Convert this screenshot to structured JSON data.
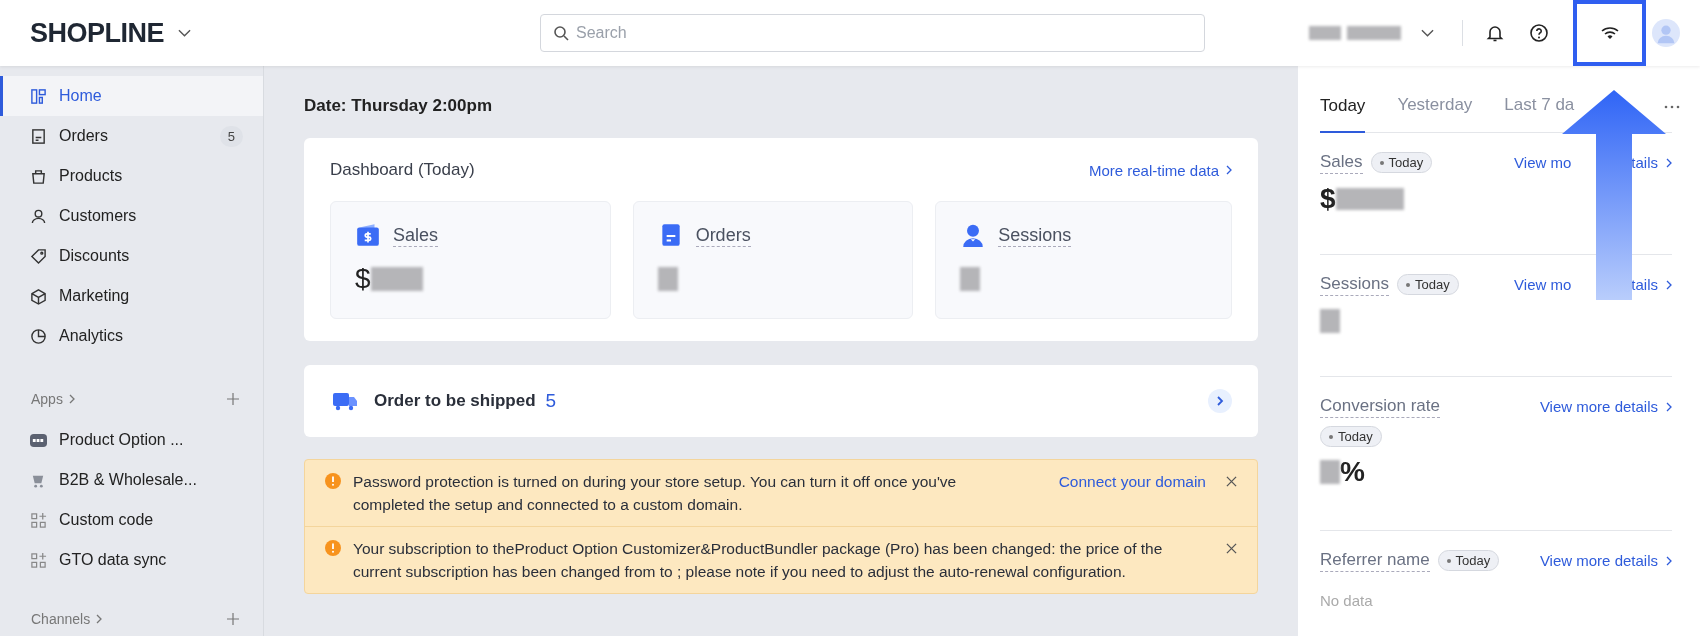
{
  "header": {
    "logo": "SHOPLINE",
    "search": {
      "placeholder": "Search"
    }
  },
  "sidebar": {
    "nav": [
      {
        "label": "Home",
        "selected": true
      },
      {
        "label": "Orders",
        "badge": "5",
        "selected": false
      },
      {
        "label": "Products",
        "selected": false
      },
      {
        "label": "Customers",
        "selected": false
      },
      {
        "label": "Discounts",
        "selected": false
      },
      {
        "label": "Marketing",
        "selected": false
      },
      {
        "label": "Analytics",
        "selected": false
      }
    ],
    "apps_header": "Apps",
    "apps": [
      {
        "label": "Product Option ..."
      },
      {
        "label": "B2B & Wholesale..."
      },
      {
        "label": "Custom code"
      },
      {
        "label": "GTO data sync"
      }
    ],
    "channels_header": "Channels"
  },
  "main": {
    "date": "Date: Thursday 2:00pm",
    "dashboard": {
      "title": "Dashboard (Today)",
      "link": "More real-time data",
      "stats": [
        {
          "label": "Sales",
          "prefix": "$"
        },
        {
          "label": "Orders"
        },
        {
          "label": "Sessions"
        }
      ]
    },
    "shipping": {
      "label": "Order to be shipped",
      "count": "5"
    },
    "alerts": [
      {
        "text": "Password protection is turned on during your store setup. You can turn it off once you've completed the setup and connected to a custom domain.",
        "link": "Connect your domain"
      },
      {
        "text": "Your subscription to theProduct Option Customizer&ProductBundler package (Pro) has been changed: the price of the current subscription has been changed from to ; please note if you need to adjust the auto-renewal configuration."
      }
    ]
  },
  "right_panel": {
    "tabs": [
      {
        "label": "Today",
        "selected": true
      },
      {
        "label": "Yesterday",
        "selected": false
      },
      {
        "label": "Last 7 da",
        "selected": false
      }
    ],
    "metrics": [
      {
        "label": "Sales",
        "badge": "Today",
        "kind": "inline",
        "link": [
          "View mo",
          "tails"
        ],
        "prefix": "$"
      },
      {
        "label": "Sessions",
        "badge": "Today",
        "kind": "inline",
        "link": [
          "View mo",
          "tails"
        ]
      },
      {
        "label": "Conversion rate",
        "badge": "Today",
        "kind": "below",
        "link": [
          "View more details"
        ],
        "suffix": "%"
      },
      {
        "label": "Referrer name",
        "badge": "Today",
        "kind": "inline",
        "link": [
          "View more details"
        ],
        "empty": "No data"
      }
    ]
  }
}
